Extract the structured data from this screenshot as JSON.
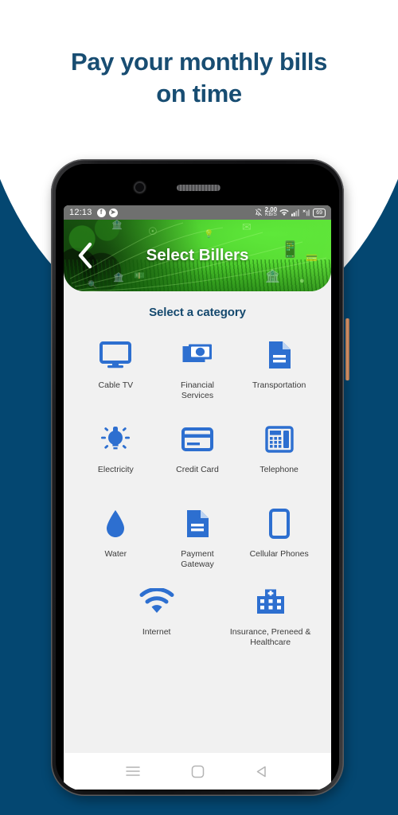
{
  "promo": {
    "headline_line1": "Pay your monthly bills",
    "headline_line2": "on time",
    "headline_color": "#184D72",
    "background_color": "#044771"
  },
  "phone": {
    "status_bar": {
      "time": "12:13",
      "facebook_glyph": "f",
      "messenger_glyph": "➤",
      "notification_icon": "bell-off-icon",
      "data_rate_value": "2.00",
      "data_rate_unit": "KB/S",
      "wifi_icon": "wifi-icon",
      "signal_icon": "signal-bars-icon",
      "sim_icon": "sim-no-service-icon",
      "battery_level": "69"
    },
    "banner": {
      "title": "Select Billers",
      "back_icon": "back-chevron-icon",
      "accent_color": "#46c229",
      "overlay_icons": [
        "bank-icon",
        "envelope-icon",
        "mobile-payment-icon",
        "money-icon",
        "location-pin-icon",
        "shopping-icon",
        "card-icon",
        "bulb-icon",
        "search-icon"
      ]
    },
    "screen": {
      "section_heading": "Select a category",
      "heading_color": "#15496E",
      "icon_color": "#2D6FD0",
      "categories": [
        {
          "label": "Cable TV",
          "icon": "monitor-icon"
        },
        {
          "label": "Financial\nServices",
          "icon": "banknote-icon"
        },
        {
          "label": "Transportation",
          "icon": "document-icon"
        },
        {
          "label": "Electricity",
          "icon": "lightbulb-icon"
        },
        {
          "label": "Credit Card",
          "icon": "credit-card-icon"
        },
        {
          "label": "Telephone",
          "icon": "desk-phone-icon"
        },
        {
          "label": "Water",
          "icon": "water-drop-icon"
        },
        {
          "label": "Payment\nGateway",
          "icon": "document-lines-icon"
        },
        {
          "label": "Cellular Phones",
          "icon": "smartphone-icon"
        },
        {
          "label": "Internet",
          "icon": "wifi-signal-icon"
        },
        {
          "label": "Insurance, Preneed &\nHealthcare",
          "icon": "hospital-icon"
        }
      ]
    },
    "nav_bar": {
      "recents_icon": "recents-menu-icon",
      "home_icon": "home-square-icon",
      "back_icon": "back-triangle-icon"
    }
  }
}
